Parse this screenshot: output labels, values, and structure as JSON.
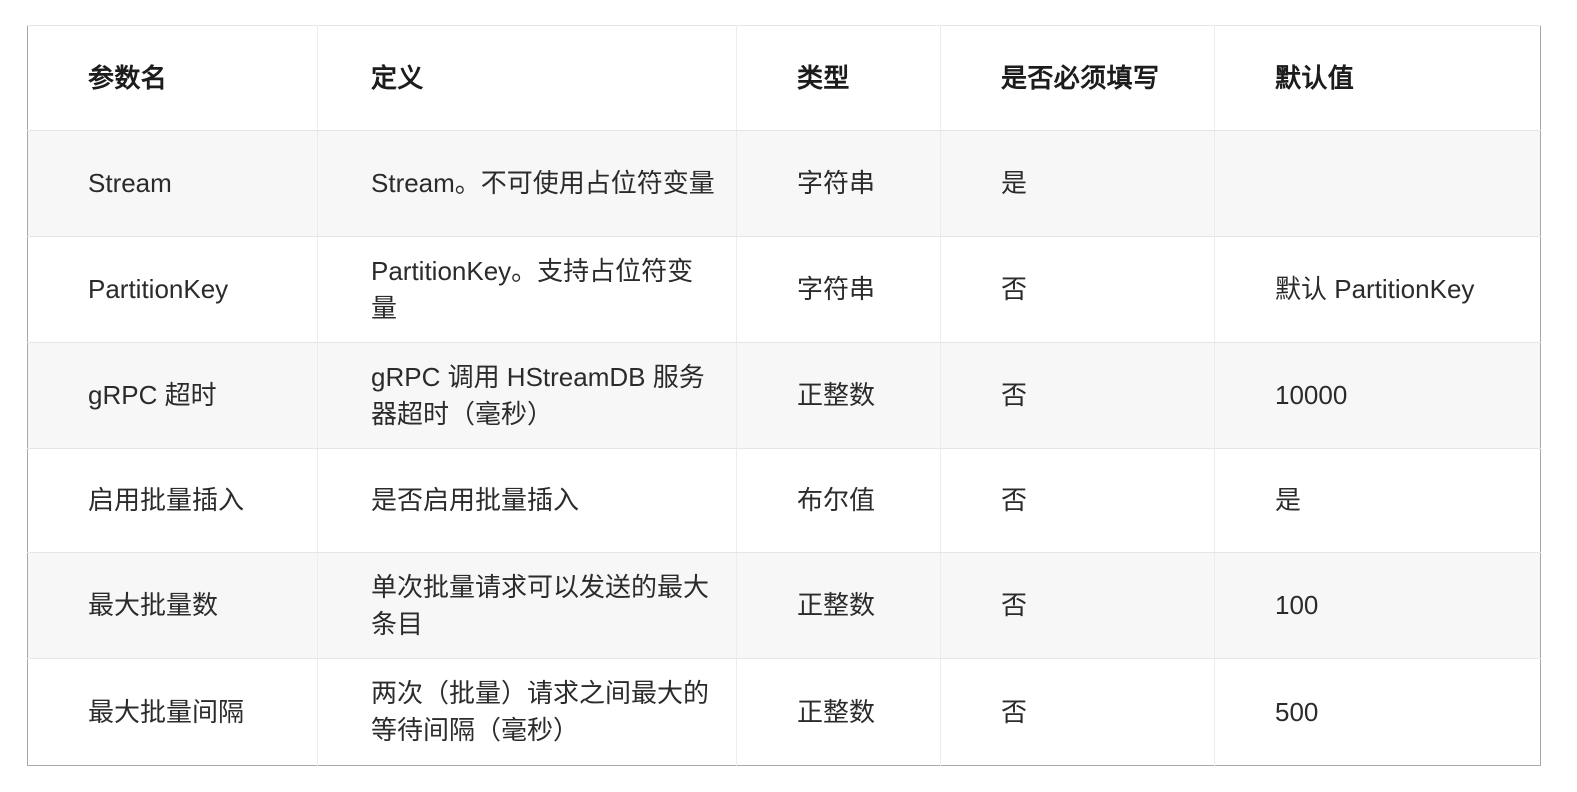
{
  "table": {
    "name": "parameter-reference-table",
    "headers": [
      {
        "key": "param_name",
        "label": "参数名"
      },
      {
        "key": "definition",
        "label": "定义"
      },
      {
        "key": "type",
        "label": "类型"
      },
      {
        "key": "required",
        "label": "是否必须填写"
      },
      {
        "key": "default",
        "label": "默认值"
      }
    ],
    "rows": [
      {
        "param_name": "Stream",
        "definition": "Stream。不可使用占位符变量",
        "type": "字符串",
        "required": "是",
        "default": ""
      },
      {
        "param_name": "PartitionKey",
        "definition": "PartitionKey。支持占位符变量",
        "type": "字符串",
        "required": "否",
        "default": "默认 PartitionKey"
      },
      {
        "param_name": "gRPC 超时",
        "definition": "gRPC 调用 HStreamDB 服务器超时（毫秒）",
        "type": "正整数",
        "required": "否",
        "default": "10000"
      },
      {
        "param_name": "启用批量插入",
        "definition": "是否启用批量插入",
        "type": "布尔值",
        "required": "否",
        "default": "是"
      },
      {
        "param_name": "最大批量数",
        "definition": "单次批量请求可以发送的最大条目",
        "type": "正整数",
        "required": "否",
        "default": "100"
      },
      {
        "param_name": "最大批量间隔",
        "definition": "两次（批量）请求之间最大的等待间隔（毫秒）",
        "type": "正整数",
        "required": "否",
        "default": "500"
      }
    ]
  },
  "style": {
    "outer_border_color": "#a8a8a8",
    "inner_border_color": "#e6e6e6",
    "shaded_row_color": "#f7f7f7",
    "plain_row_color": "#ffffff",
    "header_text_color": "#1c1c1c",
    "body_text_color": "#2b2b2b",
    "page_background": "#ffffff"
  }
}
